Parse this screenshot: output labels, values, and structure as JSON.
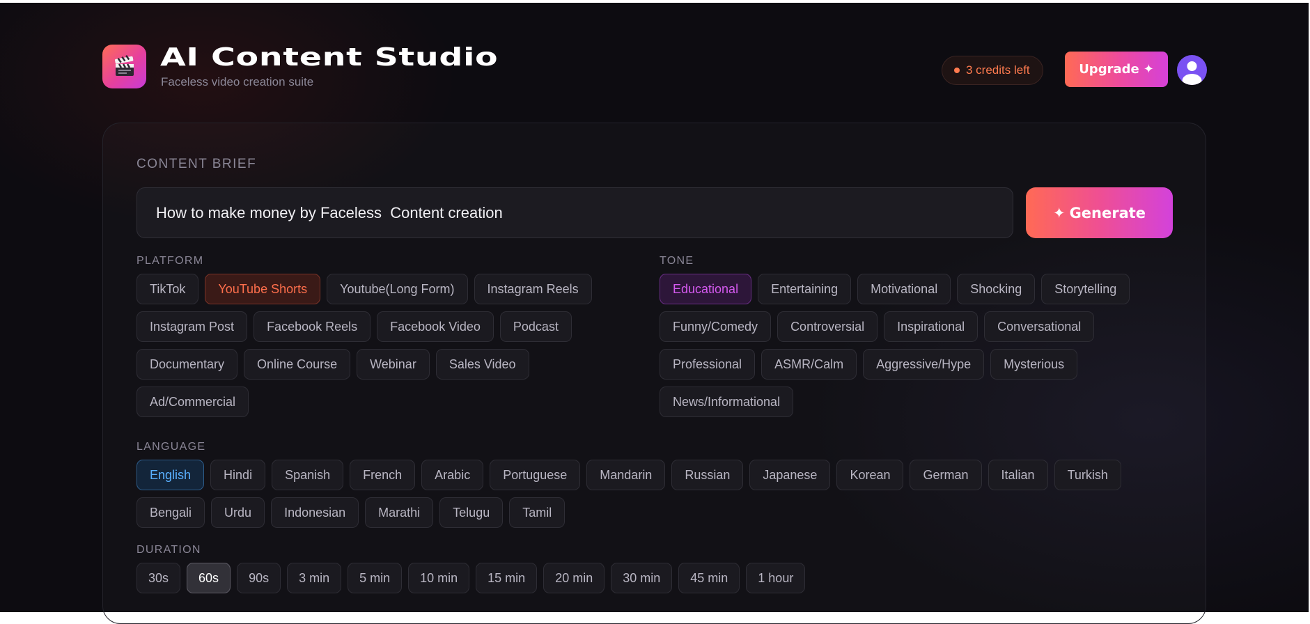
{
  "header": {
    "title": "AI Content Studio",
    "subtitle": "Faceless video creation suite",
    "logo_icon": "clapperboard-icon",
    "credits_text": "3 credits left",
    "upgrade_label": "Upgrade",
    "avatar_icon": "user-icon"
  },
  "brief": {
    "label": "CONTENT BRIEF",
    "value": "How to make money by Faceless  Content creation",
    "generate_label": "Generate"
  },
  "platform": {
    "label": "PLATFORM",
    "options": [
      "TikTok",
      "YouTube Shorts",
      "Youtube(Long Form)",
      "Instagram Reels",
      "Instagram Post",
      "Facebook Reels",
      "Facebook Video",
      "Podcast",
      "Documentary",
      "Online Course",
      "Webinar",
      "Sales Video",
      "Ad/Commercial"
    ],
    "selected": "YouTube Shorts"
  },
  "tone": {
    "label": "TONE",
    "options": [
      "Educational",
      "Entertaining",
      "Motivational",
      "Shocking",
      "Storytelling",
      "Funny/Comedy",
      "Controversial",
      "Inspirational",
      "Conversational",
      "Professional",
      "ASMR/Calm",
      "Aggressive/Hype",
      "Mysterious",
      "News/Informational"
    ],
    "selected": "Educational"
  },
  "language": {
    "label": "LANGUAGE",
    "options": [
      "English",
      "Hindi",
      "Spanish",
      "French",
      "Arabic",
      "Portuguese",
      "Mandarin",
      "Russian",
      "Japanese",
      "Korean",
      "German",
      "Italian",
      "Turkish",
      "Bengali",
      "Urdu",
      "Indonesian",
      "Marathi",
      "Telugu",
      "Tamil"
    ],
    "selected": "English"
  },
  "duration": {
    "label": "DURATION",
    "options": [
      "30s",
      "60s",
      "90s",
      "3 min",
      "5 min",
      "10 min",
      "15 min",
      "20 min",
      "30 min",
      "45 min",
      "1 hour"
    ],
    "selected": "60s"
  },
  "colors": {
    "accent_gradient_start": "#ff6a55",
    "accent_gradient_end": "#d342db",
    "platform_selected": "#ff6f4c",
    "tone_selected": "#d55af0",
    "language_selected": "#5ab0ff",
    "background": "#0d0c11"
  }
}
